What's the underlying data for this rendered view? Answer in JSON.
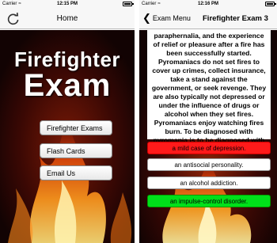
{
  "colors": {
    "wrong_answer": "#ff1a1a",
    "correct_answer": "#00e01a",
    "nav_background": "#f7f7f7",
    "screen_background": "#120303"
  },
  "left": {
    "status": {
      "carrier": "Carrier",
      "time": "12:15 PM"
    },
    "nav": {
      "title": "Home",
      "left_icon": "refresh-icon"
    },
    "logo": {
      "line1": "Firefighter",
      "line2": "Exam"
    },
    "menu": [
      {
        "label": "Firefighter Exams"
      },
      {
        "label": "Flash Cards"
      },
      {
        "label": "Email Us"
      }
    ]
  },
  "right": {
    "status": {
      "carrier": "Carrier",
      "time": "12:16 PM"
    },
    "nav": {
      "back_label": "Exam Menu",
      "back_icon": "chevron-left-icon",
      "title": "Firefighter Exam 3"
    },
    "question": "paraphernalia, and the experience of relief or pleasure after a fire has been successfully started. Pyromaniacs do not set fires to cover up crimes, collect insurance, take a stand against the government, or seek revenge. They are also typically not depressed or under the influence of drugs or alcohol when they set fires. Pyromaniacs enjoy watching fires burn. To be diagnosed with pyromania is to be diagnosed with",
    "answers": [
      {
        "label": "a mild case of depression.",
        "state": "wrong"
      },
      {
        "label": "an antisocial personality.",
        "state": "neutral"
      },
      {
        "label": "an alcohol addiction.",
        "state": "neutral"
      },
      {
        "label": "an impulse-control disorder.",
        "state": "correct"
      }
    ]
  }
}
